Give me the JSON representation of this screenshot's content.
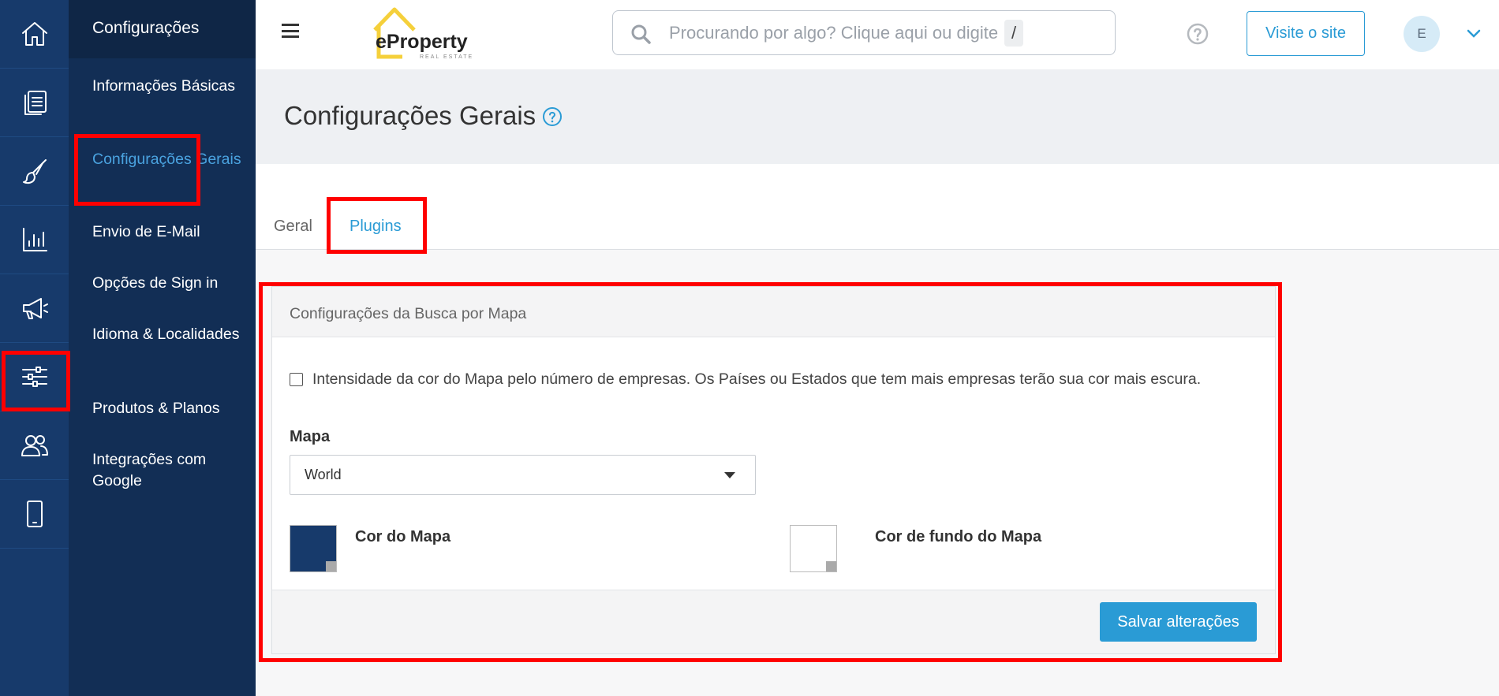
{
  "rail": {
    "items": [
      {
        "icon": "home-icon"
      },
      {
        "icon": "documents-icon"
      },
      {
        "icon": "brush-icon"
      },
      {
        "icon": "bar-chart-icon"
      },
      {
        "icon": "megaphone-icon"
      },
      {
        "icon": "sliders-icon"
      },
      {
        "icon": "users-icon"
      },
      {
        "icon": "mobile-icon"
      }
    ]
  },
  "subnav": {
    "title": "Configurações",
    "items": [
      {
        "label": "Informações Básicas"
      },
      {
        "label": "Configurações Gerais"
      },
      {
        "label": "Envio de E-Mail"
      },
      {
        "label": "Opções de Sign in"
      },
      {
        "label": "Idioma & Localidades"
      },
      {
        "label": "Produtos & Planos"
      },
      {
        "label": "Integrações com Google"
      }
    ]
  },
  "topbar": {
    "logo_text": "eProperty",
    "logo_sub": "REAL ESTATE",
    "search_placeholder": "Procurando por algo? Clique aqui ou digite",
    "search_shortcut": "/",
    "visit_label": "Visite o site",
    "avatar_initial": "E"
  },
  "page": {
    "title": "Configurações Gerais",
    "tabs": [
      {
        "label": "Geral"
      },
      {
        "label": "Plugins"
      }
    ]
  },
  "panel": {
    "title": "Configurações da Busca por Mapa",
    "checkbox_label": "Intensidade da cor do Mapa pelo número de empresas. Os Países ou Estados que tem mais empresas terão sua cor mais escura.",
    "checkbox_checked": false,
    "map_label": "Mapa",
    "map_value": "World",
    "color_label": "Cor do Mapa",
    "color_value": "#173a6b",
    "bg_color_label": "Cor de fundo do Mapa",
    "bg_color_value": "#ffffff",
    "save_label": "Salvar alterações"
  },
  "colors": {
    "rail_bg": "#173a6b",
    "subnav_bg": "#122e55",
    "accent": "#2a9bd5",
    "highlight": "#ff0000"
  }
}
